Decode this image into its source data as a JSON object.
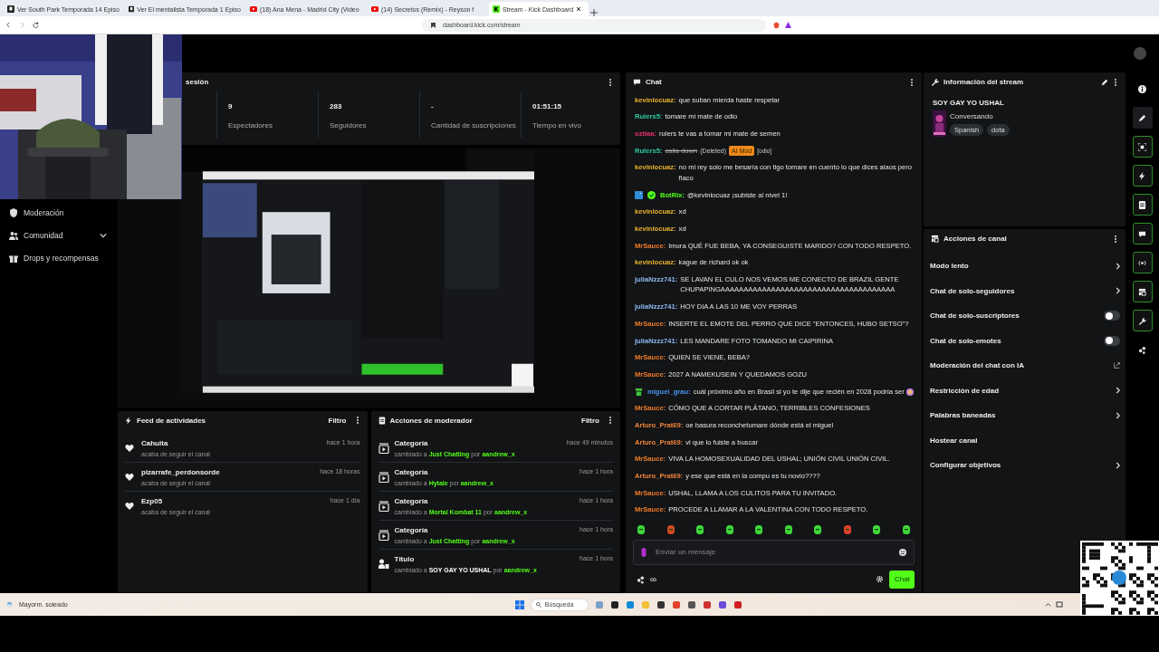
{
  "browser": {
    "tabs": [
      {
        "title": "Ver South Park Temporada 14 Episo",
        "selected": false
      },
      {
        "title": "Ver El mentalista Temporada 1 Episo",
        "selected": false
      },
      {
        "title": "(18) Ana Mena - Madrid City (Video",
        "selected": false
      },
      {
        "title": "(14) Secretos (Remix) - Reyson f",
        "selected": false
      },
      {
        "title": "Stream - Kick Dashboard",
        "selected": true
      }
    ],
    "url": "dashboard.kick.com/stream"
  },
  "sidebar": {
    "items": [
      {
        "label": "Moderación",
        "expandable": false
      },
      {
        "label": "Comunidad",
        "expandable": true
      },
      {
        "label": "Drops y recompensas",
        "expandable": false
      }
    ]
  },
  "session": {
    "title": "sesión",
    "stats": [
      {
        "value": "9",
        "label": "Espectadores"
      },
      {
        "value": "283",
        "label": "Seguidores"
      },
      {
        "value": "-",
        "label": "Cantidad de suscripciones"
      },
      {
        "value": "01:51:15",
        "label": "Tiempo en vivo"
      }
    ]
  },
  "activity_feed": {
    "title": "Feed de actividades",
    "filter": "Filtro",
    "items": [
      {
        "name": "Cahuita",
        "detail": "acaba de seguir el canal",
        "time": "hace 1 hora"
      },
      {
        "name": "pizarrafe_perdonsorde",
        "detail": "acaba de seguir el canal",
        "time": "hace 18 horas"
      },
      {
        "name": "Ezp05",
        "detail": "acaba de seguir el canal",
        "time": "hace 1 día"
      }
    ]
  },
  "mod_actions": {
    "title": "Acciones de moderador",
    "filter": "Filtro",
    "items": [
      {
        "kind": "category",
        "title": "Categoría",
        "time": "hace 49 minutos",
        "prefix": "cambiado a",
        "target": "Just Chatting",
        "by": "por",
        "user": "aandrew_x"
      },
      {
        "kind": "category",
        "title": "Categoría",
        "time": "hace 1 hora",
        "prefix": "cambiado a",
        "target": "Hytale",
        "by": "por",
        "user": "aandrew_x"
      },
      {
        "kind": "category",
        "title": "Categoría",
        "time": "hace 1 hora",
        "prefix": "cambiado a",
        "target": "Mortal Kombat 11",
        "by": "por",
        "user": "aandrew_x"
      },
      {
        "kind": "category",
        "title": "Categoría",
        "time": "hace 1 hora",
        "prefix": "cambiado a",
        "target": "Just Chatting",
        "by": "por",
        "user": "aandrew_x"
      },
      {
        "kind": "title",
        "title": "Título",
        "time": "hace 1 hora",
        "prefix": "cambiado a",
        "target": "SOY GAY YO USHAL",
        "by": "por",
        "user": "aandrew_x"
      }
    ]
  },
  "chat": {
    "title": "Chat",
    "messages": [
      {
        "user": "kevinlocuaz:",
        "color": "#e8b12c",
        "text": "que suban mierda haste respetar"
      },
      {
        "user": "Rulers5:",
        "color": "#2fc8a0",
        "text": "tomare mi mate de odio"
      },
      {
        "user": "oztiaa:",
        "color": "#e2306c",
        "text": "rulers te vas a tomar mi mate de semen"
      },
      {
        "kind": "deleted",
        "user": "Rulers5:",
        "color": "#2fc8a0",
        "text": "calla down",
        "deleted_label": "(Deleted)",
        "tag": "AI Mod",
        "reason": "[odio]"
      },
      {
        "user": "kevinlocuaz:",
        "color": "#e8b12c",
        "text": "no mi rey solo me besaría con tigo tomare en cuento lo que dices alaos pero flaco"
      },
      {
        "user": "BotRix:",
        "color": "#53fc18",
        "text": "@kevinlocuaz ¡subiste al nivel 1!",
        "kind": "bot"
      },
      {
        "user": "kevinlocuaz:",
        "color": "#e8b12c",
        "text": "xd"
      },
      {
        "user": "kevinlocuaz:",
        "color": "#e8b12c",
        "text": "xd"
      },
      {
        "user": "MrSauce:",
        "color": "#f07a2a",
        "text": "Imura QUÉ FUE BEBA, YA CONSEGUISTE MARIDO? CON TODO RESPETO."
      },
      {
        "user": "kevinlocuaz:",
        "color": "#e8b12c",
        "text": "kague de richard ok ok"
      },
      {
        "user": "juliaNzzz741:",
        "color": "#8fb8f0",
        "text": "SE LAVAN EL CULO NOS VEMOS ME CONECTO DE BRAZIL GENTE CHUPAPINGAAAAAAAAAAAAAAAAAAAAAAAAAAAAAAAAAAAAAA"
      },
      {
        "user": "juliaNzzz741:",
        "color": "#8fb8f0",
        "text": "HOY DIA A LAS 10 ME VOY PERRAS"
      },
      {
        "user": "MrSauce:",
        "color": "#f07a2a",
        "text": "INSERTE EL EMOTE DEL PERRO QUE DICE \"ENTONCES, HUBO SETSO\"?"
      },
      {
        "user": "juliaNzzz741:",
        "color": "#8fb8f0",
        "text": "LES MANDARE FOTO TOMANDO MI CAIPIRINA"
      },
      {
        "user": "MrSauce:",
        "color": "#f07a2a",
        "text": "QUIEN SE VIENE, BEBA?"
      },
      {
        "user": "MrSauce:",
        "color": "#f07a2a",
        "text": "2027 A NAMEKUSEIN Y QUEDAMOS GOZU"
      },
      {
        "user": "miguel_grau:",
        "color": "#4c94f0",
        "text": "cuál próximo año en Brasil si yo te dije que recién en 2028 podría ser",
        "kind": "subscriber",
        "emote": true
      },
      {
        "user": "MrSauce:",
        "color": "#f07a2a",
        "text": "CÓMO QUE A CORTAR PLÁTANO, TERRIBLES CONFESIONES"
      },
      {
        "user": "Arturo_Prat69:",
        "color": "#f0843a",
        "text": "oe basura reconchetumare dónde está el miguel"
      },
      {
        "user": "Arturo_Prat69:",
        "color": "#f0843a",
        "text": "vi que lo fuiste a buscar"
      },
      {
        "user": "MrSauce:",
        "color": "#f07a2a",
        "text": "VIVA LA HOMOSEXUALIDAD DEL USHAL; UNIÓN CIVIL UNIÓN CIVIL."
      },
      {
        "user": "Arturo_Prat69:",
        "color": "#f0843a",
        "text": "y ese que está en la compu es tu novio????"
      },
      {
        "user": "MrSauce:",
        "color": "#f07a2a",
        "text": "USHAL, LLAMA A LOS CULITOS PARA TU INVITADO."
      },
      {
        "user": "MrSauce:",
        "color": "#f07a2a",
        "text": "PROCEDE A LLAMAR A LA VALENTINA CON TODO RESPETO."
      }
    ],
    "input": {
      "placeholder": "Enviar un mensaje"
    },
    "send": "Chat",
    "footer_label": "∞"
  },
  "stream_info": {
    "title": "Información del stream",
    "stream_title": "SOY GAY YO USHAL",
    "category": "Conversando",
    "tags": [
      "Spanish",
      "dota"
    ]
  },
  "channel_actions": {
    "title": "Acciones de canal",
    "items": [
      {
        "label": "Modo lento",
        "kind": "arrow"
      },
      {
        "label": "Chat de solo-seguidores",
        "kind": "arrow"
      },
      {
        "label": "Chat de solo-suscriptores",
        "kind": "toggle",
        "on": false
      },
      {
        "label": "Chat de solo-emotes",
        "kind": "toggle",
        "on": false
      },
      {
        "label": "Moderación del chat con IA",
        "kind": "external"
      },
      {
        "label": "Restricción de edad",
        "kind": "arrow"
      },
      {
        "label": "Palabras baneadas",
        "kind": "arrow"
      },
      {
        "label": "Hostear canal",
        "kind": "plain"
      },
      {
        "label": "Configurar objetivos",
        "kind": "arrow"
      }
    ]
  },
  "taskbar": {
    "weather": "Mayorm. soleado",
    "search": "Búsqueda"
  }
}
